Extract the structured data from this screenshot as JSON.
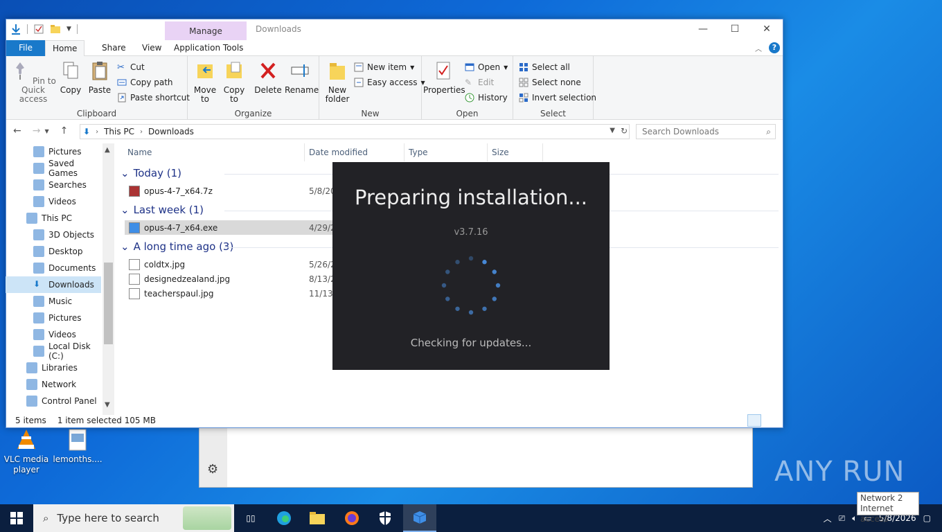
{
  "desktop": {
    "icons": [
      {
        "label": "VLC media player",
        "icon": "vlc-icon"
      },
      {
        "label": "lemonths....",
        "icon": "image-file-icon"
      }
    ],
    "watermark": "ANY RUN"
  },
  "explorer": {
    "contextual_tab": "Manage",
    "title": "Downloads",
    "tabs": {
      "file": "File",
      "home": "Home",
      "share": "Share",
      "view": "View",
      "apptools": "Application Tools"
    },
    "ribbon": {
      "clipboard": {
        "pin": "Pin to Quick access",
        "copy": "Copy",
        "paste": "Paste",
        "cut": "Cut",
        "copy_path": "Copy path",
        "paste_shortcut": "Paste shortcut",
        "label": "Clipboard"
      },
      "organize": {
        "move_to": "Move to",
        "copy_to": "Copy to",
        "delete": "Delete",
        "rename": "Rename",
        "label": "Organize"
      },
      "new": {
        "new_folder": "New folder",
        "new_item": "New item",
        "easy_access": "Easy access",
        "label": "New"
      },
      "open": {
        "properties": "Properties",
        "open": "Open",
        "edit": "Edit",
        "history": "History",
        "label": "Open"
      },
      "select": {
        "select_all": "Select all",
        "select_none": "Select none",
        "invert": "Invert selection",
        "label": "Select"
      }
    },
    "address": {
      "crumbs": [
        "This PC",
        "Downloads"
      ],
      "search_placeholder": "Search Downloads"
    },
    "nav": [
      {
        "label": "Pictures",
        "icon": "pictures-icon",
        "indent": 2
      },
      {
        "label": "Saved Games",
        "icon": "saved-games-icon",
        "indent": 2
      },
      {
        "label": "Searches",
        "icon": "searches-icon",
        "indent": 2
      },
      {
        "label": "Videos",
        "icon": "videos-icon",
        "indent": 2
      },
      {
        "label": "This PC",
        "icon": "this-pc-icon",
        "indent": 1
      },
      {
        "label": "3D Objects",
        "icon": "3d-objects-icon",
        "indent": 2
      },
      {
        "label": "Desktop",
        "icon": "desktop-icon",
        "indent": 2
      },
      {
        "label": "Documents",
        "icon": "documents-icon",
        "indent": 2
      },
      {
        "label": "Downloads",
        "icon": "downloads-icon",
        "indent": 2,
        "selected": true
      },
      {
        "label": "Music",
        "icon": "music-icon",
        "indent": 2
      },
      {
        "label": "Pictures",
        "icon": "pictures-icon",
        "indent": 2
      },
      {
        "label": "Videos",
        "icon": "videos-icon",
        "indent": 2
      },
      {
        "label": "Local Disk (C:)",
        "icon": "disk-icon",
        "indent": 2
      },
      {
        "label": "Libraries",
        "icon": "libraries-icon",
        "indent": 1
      },
      {
        "label": "Network",
        "icon": "network-icon",
        "indent": 1
      },
      {
        "label": "Control Panel",
        "icon": "control-panel-icon",
        "indent": 1
      }
    ],
    "columns": [
      "Name",
      "Date modified",
      "Type",
      "Size"
    ],
    "groups": [
      {
        "label": "Today (1)",
        "files": [
          {
            "name": "opus-4-7_x64.7z",
            "date": "5/8/20",
            "icon": "archive-icon"
          }
        ]
      },
      {
        "label": "Last week (1)",
        "files": [
          {
            "name": "opus-4-7_x64.exe",
            "date": "4/29/2",
            "icon": "installer-icon",
            "selected": true
          }
        ]
      },
      {
        "label": "A long time ago (3)",
        "files": [
          {
            "name": "coldtx.jpg",
            "date": "5/26/2",
            "icon": "image-file-icon"
          },
          {
            "name": "designedzealand.jpg",
            "date": "8/13/2",
            "icon": "image-file-icon"
          },
          {
            "name": "teacherspaul.jpg",
            "date": "11/13/",
            "icon": "image-file-icon"
          }
        ]
      }
    ],
    "status": {
      "count": "5 items",
      "selection": "1 item selected  105 MB"
    }
  },
  "installer": {
    "title": "Preparing installation...",
    "version": "v3.7.16",
    "status": "Checking for updates..."
  },
  "taskbar": {
    "search_placeholder": "Type here to search",
    "clock": "5/8/2026",
    "tooltip": {
      "line1": "Network 2",
      "line2": "Internet access"
    }
  },
  "colors": {
    "accent": "#1979ca",
    "installer_bg": "#222226",
    "spinner": "#4a8fe0"
  }
}
